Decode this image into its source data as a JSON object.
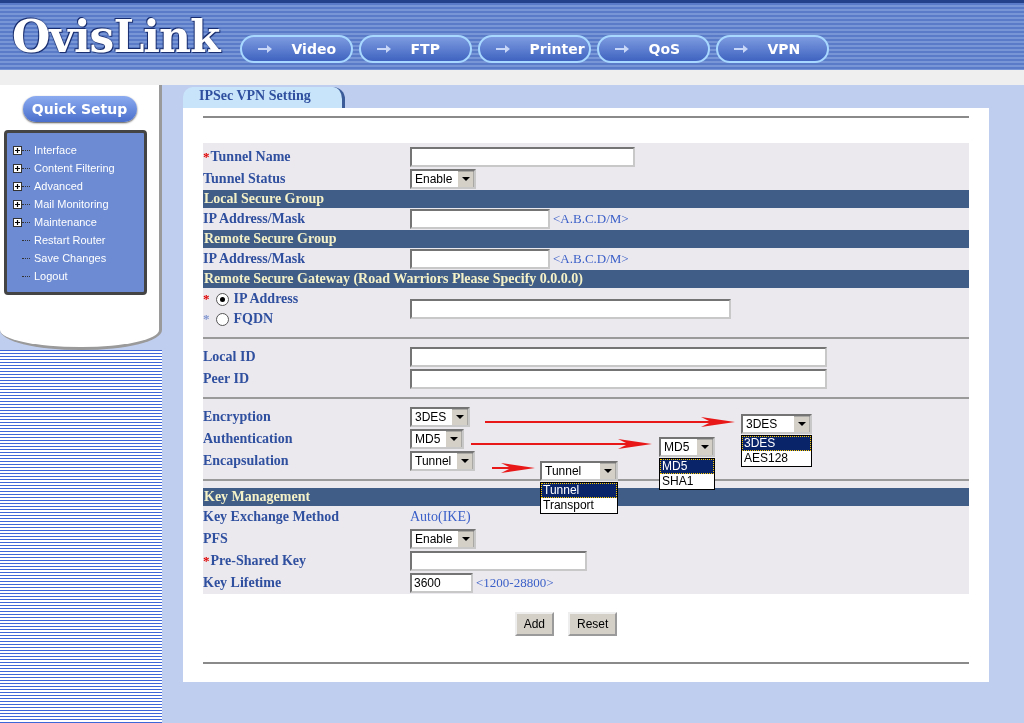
{
  "logo": "OvisLink",
  "nav_tabs": [
    {
      "label": "Video"
    },
    {
      "label": "FTP"
    },
    {
      "label": "Printer"
    },
    {
      "label": "QoS"
    },
    {
      "label": "VPN"
    }
  ],
  "sidebar": {
    "quick_setup": "Quick Setup",
    "items": [
      {
        "label": "Interface",
        "expandable": true
      },
      {
        "label": "Content Filtering",
        "expandable": true
      },
      {
        "label": "Advanced",
        "expandable": true
      },
      {
        "label": "Mail Monitoring",
        "expandable": true
      },
      {
        "label": "Maintenance",
        "expandable": true
      },
      {
        "label": "Restart Router",
        "expandable": false
      },
      {
        "label": "Save Changes",
        "expandable": false
      },
      {
        "label": "Logout",
        "expandable": false
      }
    ]
  },
  "page_tab": "IPSec VPN Setting",
  "rows": [
    {
      "kind": "text",
      "label": "Tunnel Name",
      "asterisk": "*"
    },
    {
      "kind": "select",
      "label": "Tunnel Status",
      "value": "Enable"
    },
    {
      "kind": "header",
      "label": "Local Secure Group"
    },
    {
      "kind": "text",
      "label": "IP Address/Mask",
      "hint": "<A.B.C.D/M>"
    },
    {
      "kind": "header",
      "label": "Remote Secure Group"
    },
    {
      "kind": "text",
      "label": "IP Address/Mask",
      "hint": "<A.B.C.D/M>"
    },
    {
      "kind": "header",
      "label": "Remote Secure Gateway (Road Warriors Please Specify 0.0.0.0)"
    },
    {
      "kind": "radio_group",
      "options": [
        {
          "label": "IP Address",
          "asterisk": "*",
          "selected": true
        },
        {
          "label": "FQDN",
          "asterisk": "*",
          "selected": false
        }
      ]
    },
    {
      "kind": "divider"
    },
    {
      "kind": "text",
      "label": "Local ID"
    },
    {
      "kind": "text",
      "label": "Peer ID"
    },
    {
      "kind": "divider"
    },
    {
      "kind": "select",
      "label": "Encryption",
      "value": "3DES"
    },
    {
      "kind": "select",
      "label": "Authentication",
      "value": "MD5"
    },
    {
      "kind": "select",
      "label": "Encapsulation",
      "value": "Tunnel"
    },
    {
      "kind": "divider"
    },
    {
      "kind": "header",
      "label": "Key Management"
    },
    {
      "kind": "static",
      "label": "Key Exchange Method",
      "value": "Auto(IKE)"
    },
    {
      "kind": "select",
      "label": "PFS",
      "value": "Enable"
    },
    {
      "kind": "text",
      "label": "Pre-Shared Key",
      "asterisk": "*"
    },
    {
      "kind": "text",
      "label": "Key Lifetime",
      "value": "3600",
      "hint": "<1200-28800>"
    }
  ],
  "buttons": [
    "Add",
    "Reset"
  ],
  "callouts": [
    {
      "value": "3DES",
      "options": [
        {
          "label": "3DES",
          "selected": true
        },
        {
          "label": "AES128",
          "selected": false
        }
      ]
    },
    {
      "value": "MD5",
      "options": [
        {
          "label": "MD5",
          "selected": true
        },
        {
          "label": "SHA1",
          "selected": false
        }
      ]
    },
    {
      "value": "Tunnel",
      "options": [
        {
          "label": "Tunnel",
          "selected": true
        },
        {
          "label": "Transport",
          "selected": false
        }
      ]
    }
  ]
}
